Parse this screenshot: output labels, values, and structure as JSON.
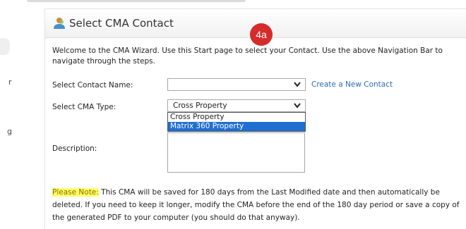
{
  "panel": {
    "title": "Select CMA Contact",
    "step_badge": "4a"
  },
  "intro_text": "Welcome to the CMA Wizard. Use this Start page to select your Contact. Use the above Navigation Bar to navigate through the steps.",
  "contact": {
    "label": "Select Contact Name:",
    "value": "",
    "create_link": "Create a New Contact"
  },
  "cma_type": {
    "label": "Select CMA Type:",
    "value": "Cross Property",
    "options": [
      "Cross Property",
      "Matrix 360 Property"
    ],
    "highlighted": "Matrix 360 Property"
  },
  "description": {
    "label": "Description:",
    "value": ""
  },
  "note": {
    "label": "Please Note:",
    "text": " This CMA will be saved for 180 days from the Last Modified date and then automatically be deleted. If you need to keep it longer, modify the CMA before the end of the 180 day period or save a copy of the generated PDF to your computer (you should do that anyway)."
  },
  "left_fragments": [
    "r",
    "g"
  ],
  "colors": {
    "badge": "#d62b2b",
    "highlight": "#1f6fd1",
    "link": "#2a6bb8",
    "note_bg": "#ffff66"
  }
}
